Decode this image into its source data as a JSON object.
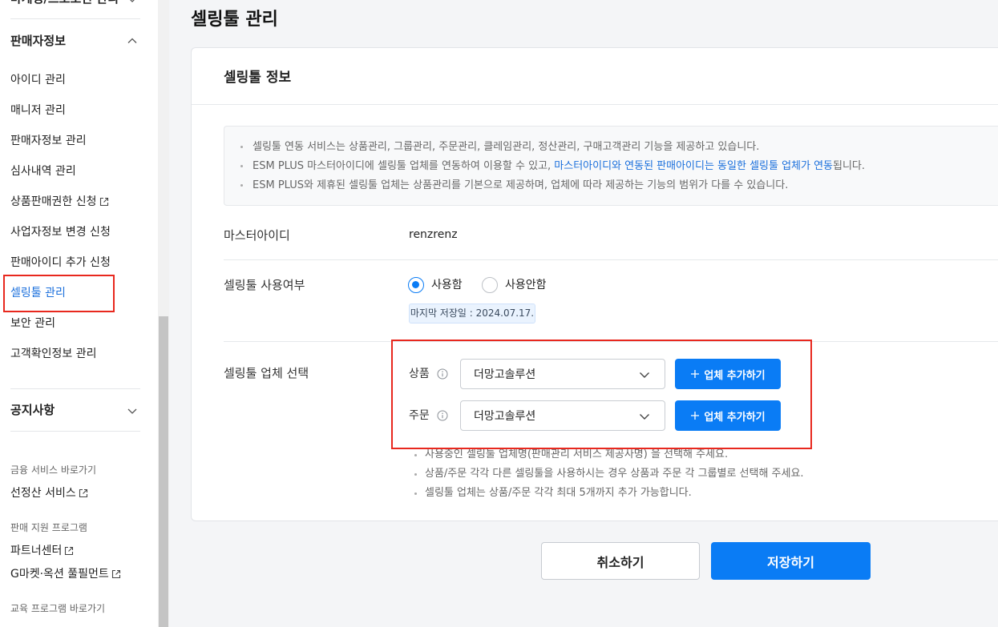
{
  "theme": {
    "accent": "#0a7cf5",
    "accent_text": "#1a6fdc",
    "annotation_red": "#e8281e",
    "main_bg": "#f4f5f7"
  },
  "sidebar": {
    "cut_section": {
      "title": "마케팅/프로모션 관리",
      "icon": "chevron-down-icon"
    },
    "seller_section": {
      "title": "판매자정보",
      "icon": "chevron-up-icon",
      "items": [
        {
          "label": "아이디 관리"
        },
        {
          "label": "매니저 관리"
        },
        {
          "label": "판매자정보 관리"
        },
        {
          "label": "심사내역 관리"
        },
        {
          "label": "상품판매권한 신청",
          "icon": "external-link-icon"
        },
        {
          "label": "사업자정보 변경 신청"
        },
        {
          "label": "판매아이디 추가 신청"
        },
        {
          "label": "셀링툴 관리",
          "active": true
        },
        {
          "label": "보안 관리"
        },
        {
          "label": "고객확인정보 관리"
        }
      ]
    },
    "notice_section": {
      "title": "공지사항",
      "icon": "chevron-down-icon"
    },
    "shortcut_groups": [
      {
        "title": "금융 서비스 바로가기",
        "links": [
          {
            "label": "선정산 서비스",
            "icon": "external-link-icon"
          }
        ]
      },
      {
        "title": "판매 지원 프로그램",
        "links": [
          {
            "label": "파트너센터",
            "icon": "external-link-icon"
          },
          {
            "label": "G마켓·옥션 풀필먼트",
            "icon": "external-link-icon"
          }
        ]
      },
      {
        "title": "교육 프로그램 바로가기",
        "links": []
      }
    ]
  },
  "page": {
    "title": "셀링툴 관리"
  },
  "card": {
    "title": "셀링툴 정보",
    "info": [
      {
        "text": "셀링툴 연동 서비스는 상품관리, 그룹관리, 주문관리, 클레임관리, 정산관리, 구매고객관리 기능을 제공하고 있습니다."
      },
      {
        "before": "ESM PLUS 마스터아이디에 셀링툴 업체를 연동하여 이용할 수 있고, ",
        "highlight": "마스터아이디와 연동된 판매아이디는 동일한 셀링툴 업체가 연동",
        "after": "됩니다."
      },
      {
        "text": "ESM PLUS와 제휴된 셀링툴 업체는 상품관리를 기본으로 제공하며, 업체에 따라 제공하는 기능의 범위가 다를 수 있습니다."
      }
    ],
    "master_id": {
      "label": "마스터아이디",
      "value": "renzrenz"
    },
    "usage": {
      "label": "셀링툴 사용여부",
      "options": [
        {
          "label": "사용함",
          "selected": true
        },
        {
          "label": "사용안함",
          "selected": false
        }
      ],
      "last_saved": "마지막 저장일 : 2024.07.17."
    },
    "vendor": {
      "label": "셀링툴 업체 선택",
      "rows": [
        {
          "label": "상품",
          "info_icon": "info-icon",
          "selected": "더망고솔루션",
          "add_button": "업체 추가하기",
          "add_icon": "plus-icon"
        },
        {
          "label": "주문",
          "info_icon": "info-icon",
          "selected": "더망고솔루션",
          "add_button": "업체 추가하기",
          "add_icon": "plus-icon"
        }
      ],
      "notes": [
        {
          "text": "사용중인 셀링툴 업체명(판매관리 서비스 제공사명) 을 선택해 주세요."
        },
        {
          "text": "상품/주문 각각 다른 셀링툴을 사용하시는 경우 상품과 주문 각 그룹별로 선택해 주세요."
        },
        {
          "text": "셀링툴 업체는 상품/주문 각각 최대 5개까지 추가 가능합니다.",
          "highlight": true
        }
      ]
    }
  },
  "actions": {
    "cancel": "취소하기",
    "save": "저장하기"
  }
}
